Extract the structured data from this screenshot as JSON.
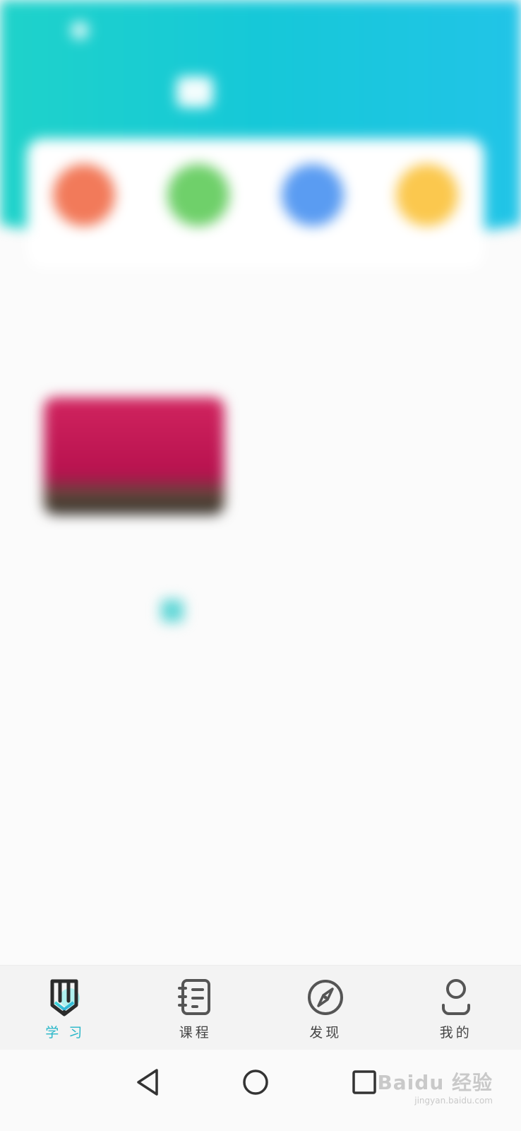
{
  "header": {
    "status_left": "",
    "status_right": "",
    "nav_left": "",
    "nav_right": "",
    "logo_text": ""
  },
  "quick_entries": [
    {
      "label": "",
      "color": "#f27a5a"
    },
    {
      "label": "",
      "color": "#6fd06a"
    },
    {
      "label": "",
      "color": "#5a9cf2"
    },
    {
      "label": "",
      "color": "#fbc84e"
    }
  ],
  "section": {
    "title": ""
  },
  "course": {
    "thumb_text": "",
    "title": "",
    "meta_left": "",
    "meta_right": ""
  },
  "more_link": {
    "label": ""
  },
  "tabbar": {
    "tabs": [
      {
        "label": "学 习",
        "icon": "pencil-icon",
        "active": true
      },
      {
        "label": "课程",
        "icon": "notebook-icon",
        "active": false
      },
      {
        "label": "发现",
        "icon": "compass-icon",
        "active": false
      },
      {
        "label": "我的",
        "icon": "person-icon",
        "active": false
      }
    ]
  },
  "colors": {
    "accent": "#25b6c8",
    "hero_start": "#1fd3c9",
    "hero_end": "#22c4e8"
  },
  "watermark": {
    "main": "Baidu 经验",
    "sub": "jingyan.baidu.com"
  }
}
